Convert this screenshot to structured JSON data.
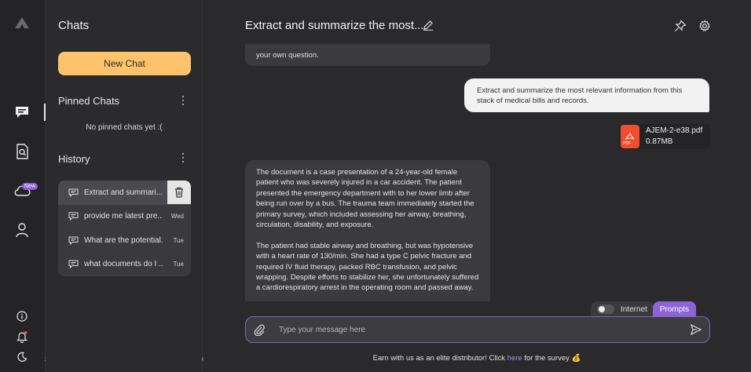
{
  "rail": {
    "icons": [
      "logo-icon",
      "chat-icon",
      "document-search-icon",
      "cloud-icon",
      "user-icon",
      "info-icon",
      "bell-icon",
      "moon-icon"
    ],
    "new_badge": "New"
  },
  "sidebar": {
    "title": "Chats",
    "new_chat_label": "New Chat",
    "pinned_title": "Pinned Chats",
    "no_pinned_text": "No pinned chats yet :(",
    "history_title": "History",
    "history": [
      {
        "label": "Extract and summari...",
        "day": ""
      },
      {
        "label": "provide me latest pre...",
        "day": "Wed"
      },
      {
        "label": "What are the potential...",
        "day": "Tue"
      },
      {
        "label": "what documents do I ...",
        "day": "Tue"
      }
    ]
  },
  "main": {
    "title": "Extract and summarize the most...",
    "partial_message": "your own question.",
    "user_message": "Extract and summarize the most relevant information from this stack of medical bills and records.",
    "file": {
      "name": "AJEM-2-e38.pdf",
      "size": "0.87MB",
      "type_label": "PDF"
    },
    "assistant_message": "The document is a case presentation of a 24-year-old female patient who was severely injured in a car accident. The patient presented the emergency department with to her lower limb after being run over by a bus. The trauma team immediately started the primary survey, which included assessing her airway, breathing, circulation, disability, and exposure.\n\nThe patient had stable airway and breathing, but was hypotensive with a heart rate of 130/min. She had a type C pelvic fracture and required IV fluid therapy, packed RBC transfusion, and pelvic wrapping. Despite efforts to stabilize her, she unfortunately suffered a cardiorespiratory arrest in the operating room and passed away.",
    "internet_label": "Internet",
    "prompts_label": "Prompts",
    "input_placeholder": "Type your message here",
    "footer_before": "Earn with us as an elite distributor! Click ",
    "footer_link": "here",
    "footer_after": " for the survey 💰"
  },
  "colors": {
    "accent_yellow": "#ffc46b",
    "accent_purple": "#8e63d8",
    "pdf_red": "#f04e2f"
  }
}
